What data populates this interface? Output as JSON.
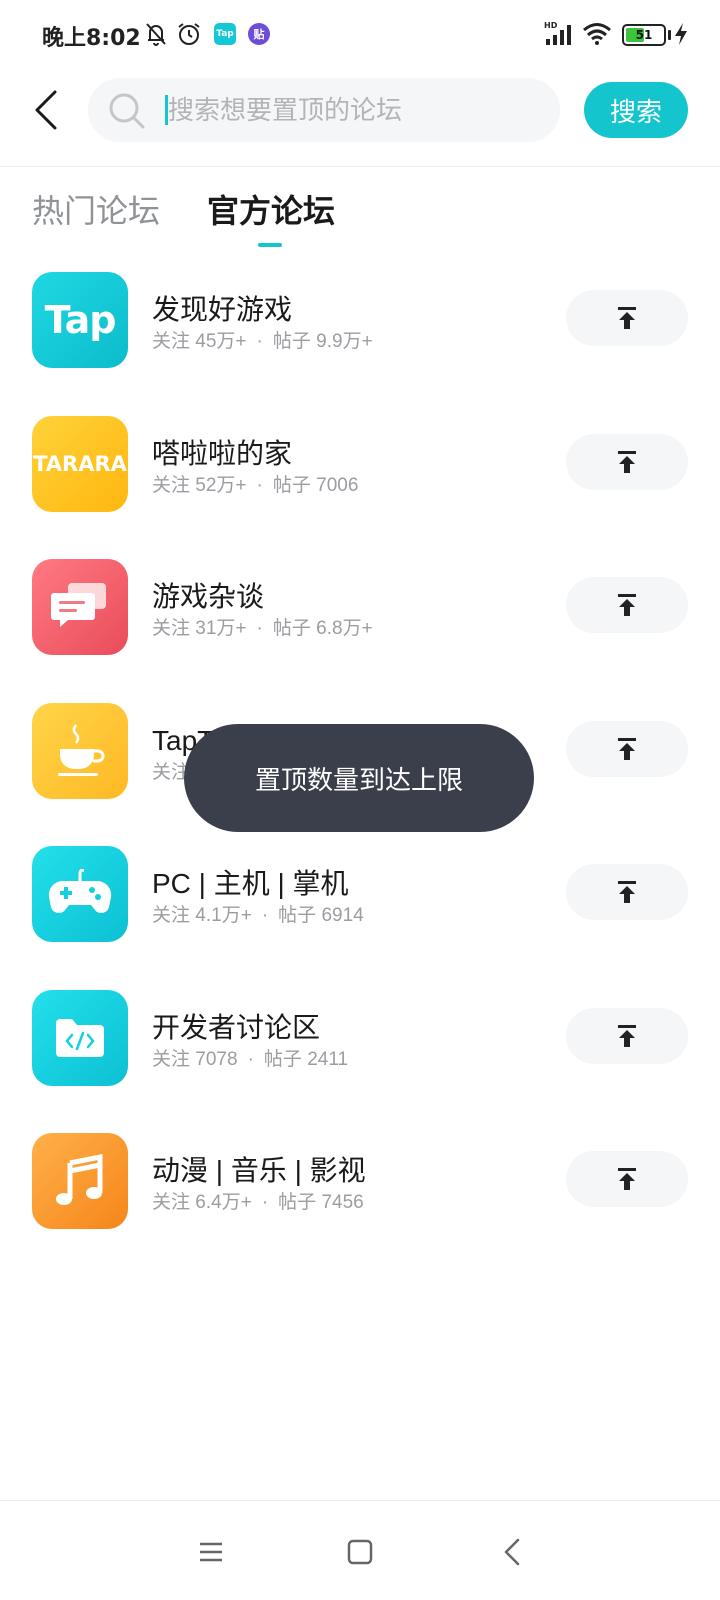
{
  "status_bar": {
    "time": "晚上8:02",
    "battery_level": "51",
    "battery_fraction": 0.51,
    "app_badge_1": "Tap",
    "app_badge_2": "贴",
    "network_label": "HD"
  },
  "header": {
    "search_placeholder": "搜索想要置顶的论坛",
    "search_value": "",
    "search_button": "搜索"
  },
  "tabs": {
    "hot": "热门论坛",
    "official": "官方论坛",
    "active": "official"
  },
  "forums": [
    {
      "name": "发现好游戏",
      "follow_label": "关注",
      "follow": "45万+",
      "post_label": "帖子",
      "posts": "9.9万+",
      "icon": "taptap-logo-icon",
      "logo_text": "Tap"
    },
    {
      "name": "嗒啦啦的家",
      "follow_label": "关注",
      "follow": "52万+",
      "post_label": "帖子",
      "posts": "7006",
      "icon": "tarara-logo-icon",
      "logo_text": "TARARA"
    },
    {
      "name": "游戏杂谈",
      "follow_label": "关注",
      "follow": "31万+",
      "post_label": "帖子",
      "posts": "6.8万+",
      "icon": "chat-bubbles-icon"
    },
    {
      "name": "TapTap 生活区",
      "follow_label": "关注",
      "follow": "",
      "post_label": "",
      "posts": "",
      "icon": "coffee-cup-icon"
    },
    {
      "name": "PC | 主机 | 掌机",
      "follow_label": "关注",
      "follow": "4.1万+",
      "post_label": "帖子",
      "posts": "6914",
      "icon": "gamepad-icon"
    },
    {
      "name": "开发者讨论区",
      "follow_label": "关注",
      "follow": "7078",
      "post_label": "帖子",
      "posts": "2411",
      "icon": "code-folder-icon"
    },
    {
      "name": "动漫 | 音乐 | 影视",
      "follow_label": "关注",
      "follow": "6.4万+",
      "post_label": "帖子",
      "posts": "7456",
      "icon": "music-note-icon"
    }
  ],
  "stats_separator": "·",
  "toast": "置顶数量到达上限",
  "colors": {
    "accent": "#15c5ce",
    "toast_bg": "#3a3f4b",
    "tap_icon": "#14c8d6",
    "tarara_icon": "#ffc21a",
    "chat_icon": "#f0616d",
    "coffee_icon": "#ffc234",
    "gamepad_icon": "#13cfe0",
    "code_icon": "#13cfe0",
    "music_icon": "#ff9a2e"
  }
}
